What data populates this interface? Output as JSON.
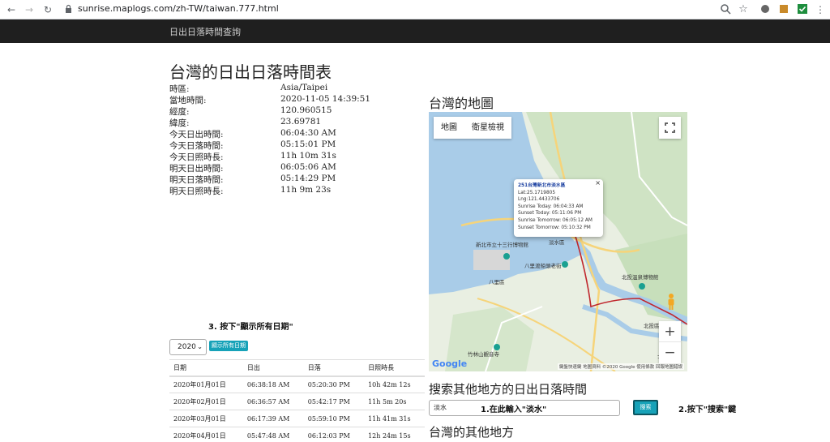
{
  "browser": {
    "url": "sunrise.maplogs.com/zh-TW/taiwan.777.html",
    "icons": [
      "back-icon",
      "forward-icon",
      "reload-icon",
      "lock-icon",
      "zoom-icon",
      "star-icon",
      "extension-icon",
      "extension-icon",
      "extension-icon"
    ]
  },
  "sitebar": {
    "brand": "日出日落時間查詢"
  },
  "page": {
    "title": "台灣的日出日落時間表",
    "info": [
      {
        "key": "時區:",
        "value": "Asia/Taipei"
      },
      {
        "key": "當地時間:",
        "value": "2020-11-05 14:39:51"
      },
      {
        "key": "經度:",
        "value": "120.960515"
      },
      {
        "key": "緯度:",
        "value": "23.69781"
      },
      {
        "key": "今天日出時間:",
        "value": "06:04:30 AM"
      },
      {
        "key": "今天日落時間:",
        "value": "05:15:01 PM"
      },
      {
        "key": "今天日照時長:",
        "value": "11h 10m 31s"
      },
      {
        "key": "明天日出時間:",
        "value": "06:05:06 AM"
      },
      {
        "key": "明天日落時間:",
        "value": "05:14:29 PM"
      },
      {
        "key": "明天日照時長:",
        "value": "11h 9m 23s"
      }
    ],
    "annotation_show_all": "3. 按下\"顯示所有日期\"",
    "year_select": "2020",
    "show_all_button": "顯示所有日期",
    "table": {
      "headers": [
        "日期",
        "日出",
        "日落",
        "日照時長"
      ],
      "rows": [
        [
          "2020年01月01日",
          "06:38:18 AM",
          "05:20:30 PM",
          "10h 42m 12s"
        ],
        [
          "2020年02月01日",
          "06:36:57 AM",
          "05:42:17 PM",
          "11h 5m 20s"
        ],
        [
          "2020年03月01日",
          "06:17:39 AM",
          "05:59:10 PM",
          "11h 41m 31s"
        ],
        [
          "2020年04月01日",
          "05:47:48 AM",
          "06:12:03 PM",
          "12h 24m 15s"
        ]
      ]
    }
  },
  "map": {
    "heading": "台灣的地圖",
    "tab_map": "地圖",
    "tab_satellite": "衛星檢視",
    "popup": {
      "title": "251台灣新北市淡水區",
      "lines": [
        "Lat:25.1719805",
        "Lng:121.4433706",
        "Sunrise Today: 06:04:33 AM",
        "Sunset Today: 05:11:06 PM",
        "Sunrise Tomorrow: 06:05:12 AM",
        "Sunset Tomorrow: 05:10:32 PM"
      ],
      "close": "×"
    },
    "labels": {
      "museum": "新北市立十三行博物館",
      "tamsui": "淡水區",
      "baliferry": "八里渡船頭老街",
      "bali": "八里區",
      "beitou_museum": "北投溫泉博物館",
      "beitou": "北投區",
      "zhuwei": "竹林山觀音寺",
      "shilin": "士林"
    },
    "zoom_in": "+",
    "zoom_out": "−",
    "logo": "Google",
    "attribution": "鍵盤快速鍵  地圖資料 ©2020 Google  使用條款  回報地圖錯誤"
  },
  "search": {
    "heading": "搜索其他地方的日出日落時間",
    "input_value": "淡水",
    "annotation_input": "1.在此輸入\"淡水\"",
    "button": "搜索",
    "annotation_button": "2.按下\"搜索\"鍵"
  },
  "other": {
    "heading": "台灣的其他地方"
  },
  "colors": {
    "accent": "#17a2b8",
    "navbar": "#1f1f1f",
    "link": "#1a3fa0"
  }
}
